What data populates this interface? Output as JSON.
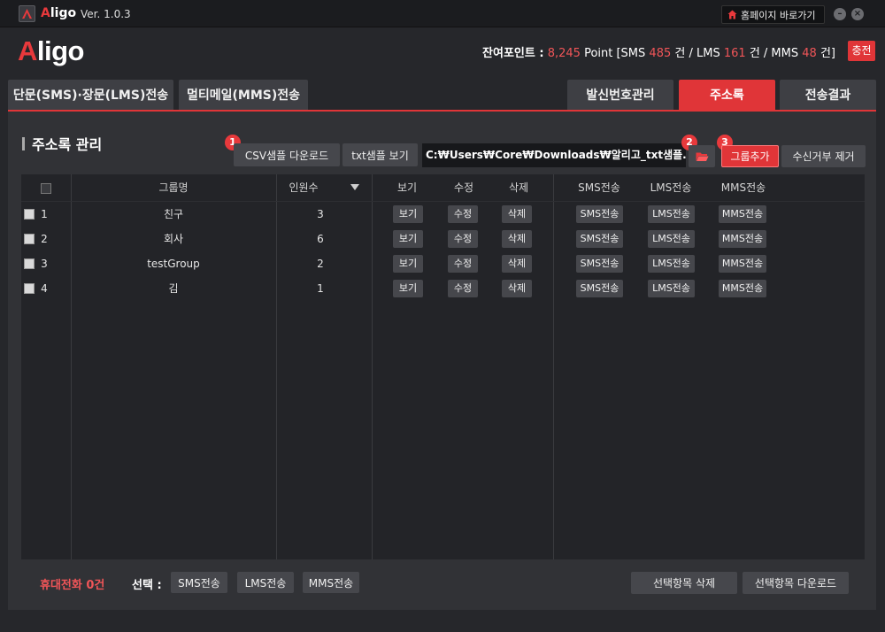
{
  "titlebar": {
    "app_name_first": "A",
    "app_name_rest": "ligo",
    "version": "Ver. 1.0.3",
    "home_button": "홈페이지 바로가기",
    "minimize": "–",
    "close": "×"
  },
  "header": {
    "brand_first": "A",
    "brand_rest": "ligo",
    "points_label": "잔여포인트 :",
    "points_value": "8,245",
    "points_unit": "Point [SMS",
    "sms_count": "485",
    "lms_label": "건 / LMS",
    "lms_count": "161",
    "mms_label": "건 / MMS",
    "mms_count": "48",
    "end_label": "건]",
    "charge_button": "충전"
  },
  "tabs": {
    "sms_lms": "단문(SMS)·장문(LMS)전송",
    "mms": "멀티메일(MMS)전송",
    "sender": "발신번호관리",
    "address": "주소록",
    "result": "전송결과"
  },
  "section": {
    "title": "주소록 관리",
    "csv_sample": "CSV샘플 다운로드",
    "txt_sample": "txt샘플 보기",
    "file_path": "C:₩Users₩Core₩Downloads₩알리고_txt샘플.txt",
    "group_add": "그룹추가",
    "reject_remove": "수신거부 제거",
    "badge1": "1",
    "badge2": "2",
    "badge3": "3"
  },
  "table": {
    "headers": {
      "group": "그룹명",
      "count": "인원수",
      "view": "보기",
      "edit": "수정",
      "delete": "삭제",
      "sms": "SMS전송",
      "lms": "LMS전송",
      "mms": "MMS전송"
    },
    "rows": [
      {
        "no": "1",
        "group": "친구",
        "count": "3"
      },
      {
        "no": "2",
        "group": "회사",
        "count": "6"
      },
      {
        "no": "3",
        "group": "testGroup",
        "count": "2"
      },
      {
        "no": "4",
        "group": "김",
        "count": "1"
      }
    ],
    "buttons": {
      "view": "보기",
      "edit": "수정",
      "delete": "삭제",
      "sms": "SMS전송",
      "lms": "LMS전송",
      "mms": "MMS전송"
    }
  },
  "footer": {
    "phone_count": "휴대전화 0건",
    "select_label": "선택 :",
    "sms": "SMS전송",
    "lms": "LMS전송",
    "mms": "MMS전송",
    "delete_selected": "선택항목 삭제",
    "download_selected": "선택항목 다운로드"
  }
}
